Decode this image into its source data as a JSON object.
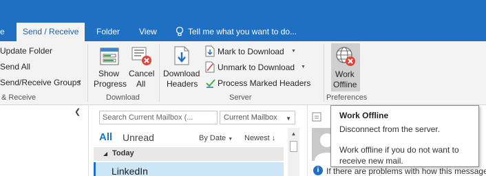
{
  "tabs": {
    "file_partial": "e",
    "send_receive": "Send / Receive",
    "folder": "Folder",
    "view": "View",
    "tell_me": "Tell me what you want to do..."
  },
  "ribbon": {
    "send_receive_group": {
      "update_folder": "Update Folder",
      "send_all": "Send All",
      "send_receive_groups": "Send/Receive Groups",
      "label_partial": "& Receive"
    },
    "download_group": {
      "show_progress_line1": "Show",
      "show_progress_line2": "Progress",
      "cancel_all_line1": "Cancel",
      "cancel_all_line2": "All",
      "label": "Download"
    },
    "server_group": {
      "download_headers_line1": "Download",
      "download_headers_line2": "Headers",
      "mark_to_download": "Mark to Download",
      "unmark_to_download": "Unmark to Download",
      "process_marked_headers": "Process Marked Headers",
      "label": "Server"
    },
    "preferences_group": {
      "work_offline_line1": "Work",
      "work_offline_line2": "Offline",
      "label": "Preferences"
    }
  },
  "mail_list": {
    "search_placeholder": "Search Current Mailbox (...",
    "scope": "Current Mailbox",
    "filter_all": "All",
    "filter_unread": "Unread",
    "sort_by": "By Date",
    "sort_order": "Newest",
    "group_today": "Today",
    "first_sender": "LinkedIn"
  },
  "reading_pane": {
    "info_text": "If there are problems with how this message"
  },
  "tooltip": {
    "title": "Work Offline",
    "description": "Disconnect from the server.",
    "detail": "Work offline if you do not want to receive new mail."
  },
  "colors": {
    "accent": "#1f6fc3",
    "ribbon_bg": "#f3f3f3",
    "selected_row": "#cde6f7",
    "cancel_red": "#e0443a"
  },
  "icons": {
    "show_progress": "progress-window-icon",
    "cancel_all": "cancel-envelope-icon",
    "download_headers": "download-document-icon",
    "work_offline": "globe-offline-icon",
    "tell_me": "lightbulb-icon"
  }
}
